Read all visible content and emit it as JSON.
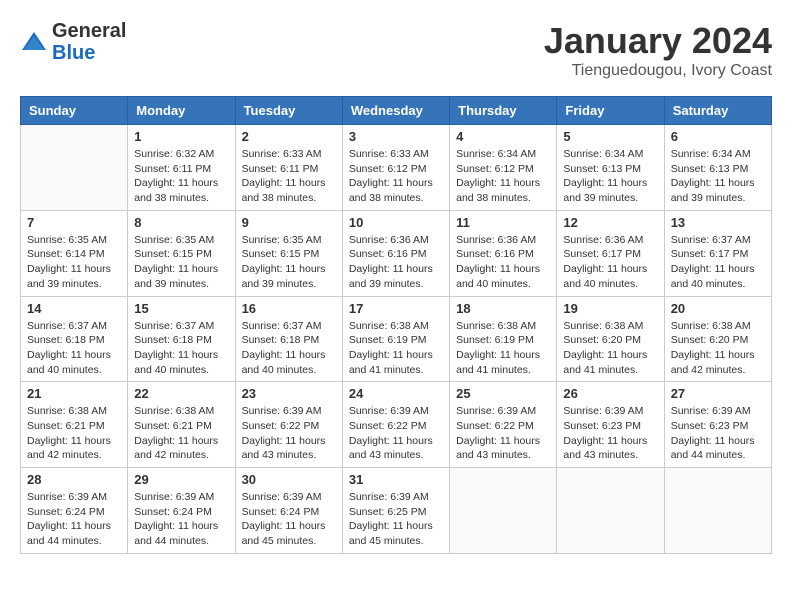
{
  "logo": {
    "general": "General",
    "blue": "Blue"
  },
  "title": "January 2024",
  "subtitle": "Tienguedougou, Ivory Coast",
  "weekdays": [
    "Sunday",
    "Monday",
    "Tuesday",
    "Wednesday",
    "Thursday",
    "Friday",
    "Saturday"
  ],
  "weeks": [
    [
      {
        "day": "",
        "sunrise": "",
        "sunset": "",
        "daylight": ""
      },
      {
        "day": "1",
        "sunrise": "Sunrise: 6:32 AM",
        "sunset": "Sunset: 6:11 PM",
        "daylight": "Daylight: 11 hours and 38 minutes."
      },
      {
        "day": "2",
        "sunrise": "Sunrise: 6:33 AM",
        "sunset": "Sunset: 6:11 PM",
        "daylight": "Daylight: 11 hours and 38 minutes."
      },
      {
        "day": "3",
        "sunrise": "Sunrise: 6:33 AM",
        "sunset": "Sunset: 6:12 PM",
        "daylight": "Daylight: 11 hours and 38 minutes."
      },
      {
        "day": "4",
        "sunrise": "Sunrise: 6:34 AM",
        "sunset": "Sunset: 6:12 PM",
        "daylight": "Daylight: 11 hours and 38 minutes."
      },
      {
        "day": "5",
        "sunrise": "Sunrise: 6:34 AM",
        "sunset": "Sunset: 6:13 PM",
        "daylight": "Daylight: 11 hours and 39 minutes."
      },
      {
        "day": "6",
        "sunrise": "Sunrise: 6:34 AM",
        "sunset": "Sunset: 6:13 PM",
        "daylight": "Daylight: 11 hours and 39 minutes."
      }
    ],
    [
      {
        "day": "7",
        "sunrise": "Sunrise: 6:35 AM",
        "sunset": "Sunset: 6:14 PM",
        "daylight": "Daylight: 11 hours and 39 minutes."
      },
      {
        "day": "8",
        "sunrise": "Sunrise: 6:35 AM",
        "sunset": "Sunset: 6:15 PM",
        "daylight": "Daylight: 11 hours and 39 minutes."
      },
      {
        "day": "9",
        "sunrise": "Sunrise: 6:35 AM",
        "sunset": "Sunset: 6:15 PM",
        "daylight": "Daylight: 11 hours and 39 minutes."
      },
      {
        "day": "10",
        "sunrise": "Sunrise: 6:36 AM",
        "sunset": "Sunset: 6:16 PM",
        "daylight": "Daylight: 11 hours and 39 minutes."
      },
      {
        "day": "11",
        "sunrise": "Sunrise: 6:36 AM",
        "sunset": "Sunset: 6:16 PM",
        "daylight": "Daylight: 11 hours and 40 minutes."
      },
      {
        "day": "12",
        "sunrise": "Sunrise: 6:36 AM",
        "sunset": "Sunset: 6:17 PM",
        "daylight": "Daylight: 11 hours and 40 minutes."
      },
      {
        "day": "13",
        "sunrise": "Sunrise: 6:37 AM",
        "sunset": "Sunset: 6:17 PM",
        "daylight": "Daylight: 11 hours and 40 minutes."
      }
    ],
    [
      {
        "day": "14",
        "sunrise": "Sunrise: 6:37 AM",
        "sunset": "Sunset: 6:18 PM",
        "daylight": "Daylight: 11 hours and 40 minutes."
      },
      {
        "day": "15",
        "sunrise": "Sunrise: 6:37 AM",
        "sunset": "Sunset: 6:18 PM",
        "daylight": "Daylight: 11 hours and 40 minutes."
      },
      {
        "day": "16",
        "sunrise": "Sunrise: 6:37 AM",
        "sunset": "Sunset: 6:18 PM",
        "daylight": "Daylight: 11 hours and 40 minutes."
      },
      {
        "day": "17",
        "sunrise": "Sunrise: 6:38 AM",
        "sunset": "Sunset: 6:19 PM",
        "daylight": "Daylight: 11 hours and 41 minutes."
      },
      {
        "day": "18",
        "sunrise": "Sunrise: 6:38 AM",
        "sunset": "Sunset: 6:19 PM",
        "daylight": "Daylight: 11 hours and 41 minutes."
      },
      {
        "day": "19",
        "sunrise": "Sunrise: 6:38 AM",
        "sunset": "Sunset: 6:20 PM",
        "daylight": "Daylight: 11 hours and 41 minutes."
      },
      {
        "day": "20",
        "sunrise": "Sunrise: 6:38 AM",
        "sunset": "Sunset: 6:20 PM",
        "daylight": "Daylight: 11 hours and 42 minutes."
      }
    ],
    [
      {
        "day": "21",
        "sunrise": "Sunrise: 6:38 AM",
        "sunset": "Sunset: 6:21 PM",
        "daylight": "Daylight: 11 hours and 42 minutes."
      },
      {
        "day": "22",
        "sunrise": "Sunrise: 6:38 AM",
        "sunset": "Sunset: 6:21 PM",
        "daylight": "Daylight: 11 hours and 42 minutes."
      },
      {
        "day": "23",
        "sunrise": "Sunrise: 6:39 AM",
        "sunset": "Sunset: 6:22 PM",
        "daylight": "Daylight: 11 hours and 43 minutes."
      },
      {
        "day": "24",
        "sunrise": "Sunrise: 6:39 AM",
        "sunset": "Sunset: 6:22 PM",
        "daylight": "Daylight: 11 hours and 43 minutes."
      },
      {
        "day": "25",
        "sunrise": "Sunrise: 6:39 AM",
        "sunset": "Sunset: 6:22 PM",
        "daylight": "Daylight: 11 hours and 43 minutes."
      },
      {
        "day": "26",
        "sunrise": "Sunrise: 6:39 AM",
        "sunset": "Sunset: 6:23 PM",
        "daylight": "Daylight: 11 hours and 43 minutes."
      },
      {
        "day": "27",
        "sunrise": "Sunrise: 6:39 AM",
        "sunset": "Sunset: 6:23 PM",
        "daylight": "Daylight: 11 hours and 44 minutes."
      }
    ],
    [
      {
        "day": "28",
        "sunrise": "Sunrise: 6:39 AM",
        "sunset": "Sunset: 6:24 PM",
        "daylight": "Daylight: 11 hours and 44 minutes."
      },
      {
        "day": "29",
        "sunrise": "Sunrise: 6:39 AM",
        "sunset": "Sunset: 6:24 PM",
        "daylight": "Daylight: 11 hours and 44 minutes."
      },
      {
        "day": "30",
        "sunrise": "Sunrise: 6:39 AM",
        "sunset": "Sunset: 6:24 PM",
        "daylight": "Daylight: 11 hours and 45 minutes."
      },
      {
        "day": "31",
        "sunrise": "Sunrise: 6:39 AM",
        "sunset": "Sunset: 6:25 PM",
        "daylight": "Daylight: 11 hours and 45 minutes."
      },
      {
        "day": "",
        "sunrise": "",
        "sunset": "",
        "daylight": ""
      },
      {
        "day": "",
        "sunrise": "",
        "sunset": "",
        "daylight": ""
      },
      {
        "day": "",
        "sunrise": "",
        "sunset": "",
        "daylight": ""
      }
    ]
  ]
}
